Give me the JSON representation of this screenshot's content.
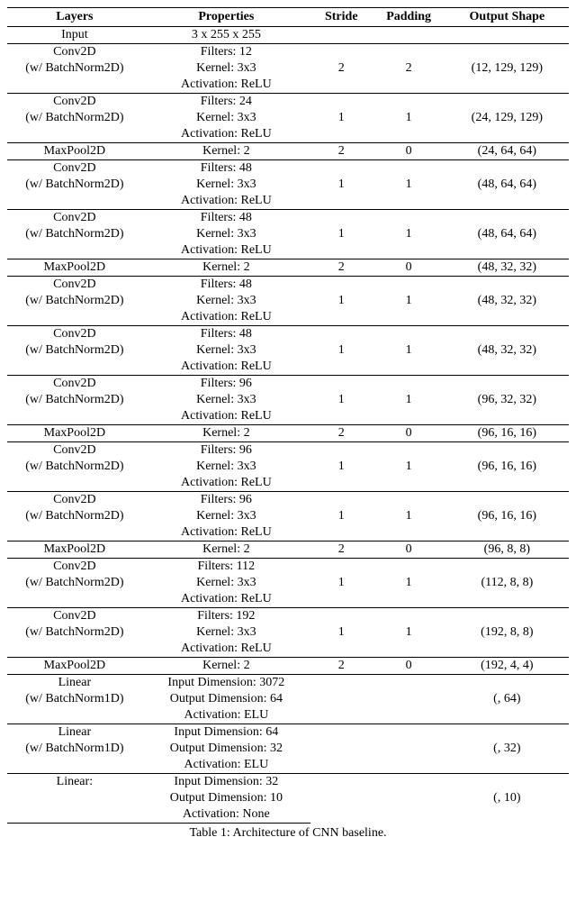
{
  "headers": [
    "Layers",
    "Properties",
    "Stride",
    "Padding",
    "Output Shape"
  ],
  "caption": "Table 1: Architecture of CNN baseline.",
  "rows": [
    {
      "type": "single",
      "layer": "Input",
      "properties": "3 x 255 x 255",
      "stride": "",
      "padding": "",
      "output": ""
    },
    {
      "type": "conv",
      "layer": "Conv2D",
      "sub": "(w/ BatchNorm2D)",
      "p1": "Filters: 12",
      "p2": "Kernel: 3x3",
      "p3": "Activation: ReLU",
      "stride": "2",
      "padding": "2",
      "output": "(12, 129, 129)"
    },
    {
      "type": "conv",
      "layer": "Conv2D",
      "sub": "(w/ BatchNorm2D)",
      "p1": "Filters: 24",
      "p2": "Kernel: 3x3",
      "p3": "Activation: ReLU",
      "stride": "1",
      "padding": "1",
      "output": "(24, 129, 129)"
    },
    {
      "type": "single",
      "layer": "MaxPool2D",
      "properties": "Kernel: 2",
      "stride": "2",
      "padding": "0",
      "output": "(24, 64, 64)"
    },
    {
      "type": "conv",
      "layer": "Conv2D",
      "sub": "(w/ BatchNorm2D)",
      "p1": "Filters: 48",
      "p2": "Kernel: 3x3",
      "p3": "Activation: ReLU",
      "stride": "1",
      "padding": "1",
      "output": "(48, 64, 64)"
    },
    {
      "type": "conv",
      "layer": "Conv2D",
      "sub": "(w/ BatchNorm2D)",
      "p1": "Filters: 48",
      "p2": "Kernel: 3x3",
      "p3": "Activation: ReLU",
      "stride": "1",
      "padding": "1",
      "output": "(48, 64, 64)"
    },
    {
      "type": "single",
      "layer": "MaxPool2D",
      "properties": "Kernel: 2",
      "stride": "2",
      "padding": "0",
      "output": "(48, 32, 32)"
    },
    {
      "type": "conv",
      "layer": "Conv2D",
      "sub": "(w/ BatchNorm2D)",
      "p1": "Filters: 48",
      "p2": "Kernel: 3x3",
      "p3": "Activation: ReLU",
      "stride": "1",
      "padding": "1",
      "output": "(48, 32, 32)"
    },
    {
      "type": "conv",
      "layer": "Conv2D",
      "sub": "(w/ BatchNorm2D)",
      "p1": "Filters: 48",
      "p2": "Kernel: 3x3",
      "p3": "Activation: ReLU",
      "stride": "1",
      "padding": "1",
      "output": "(48, 32, 32)"
    },
    {
      "type": "conv",
      "layer": "Conv2D",
      "sub": "(w/ BatchNorm2D)",
      "p1": "Filters: 96",
      "p2": "Kernel: 3x3",
      "p3": "Activation: ReLU",
      "stride": "1",
      "padding": "1",
      "output": "(96, 32, 32)"
    },
    {
      "type": "single",
      "layer": "MaxPool2D",
      "properties": "Kernel: 2",
      "stride": "2",
      "padding": "0",
      "output": "(96, 16, 16)"
    },
    {
      "type": "conv",
      "layer": "Conv2D",
      "sub": "(w/ BatchNorm2D)",
      "p1": "Filters: 96",
      "p2": "Kernel: 3x3",
      "p3": "Activation: ReLU",
      "stride": "1",
      "padding": "1",
      "output": "(96, 16, 16)"
    },
    {
      "type": "conv",
      "layer": "Conv2D",
      "sub": "(w/ BatchNorm2D)",
      "p1": "Filters: 96",
      "p2": "Kernel: 3x3",
      "p3": "Activation: ReLU",
      "stride": "1",
      "padding": "1",
      "output": "(96, 16, 16)"
    },
    {
      "type": "single",
      "layer": "MaxPool2D",
      "properties": "Kernel: 2",
      "stride": "2",
      "padding": "0",
      "output": "(96, 8, 8)"
    },
    {
      "type": "conv",
      "layer": "Conv2D",
      "sub": "(w/ BatchNorm2D)",
      "p1": "Filters: 112",
      "p2": "Kernel: 3x3",
      "p3": "Activation: ReLU",
      "stride": "1",
      "padding": "1",
      "output": "(112, 8, 8)"
    },
    {
      "type": "conv",
      "layer": "Conv2D",
      "sub": "(w/ BatchNorm2D)",
      "p1": "Filters: 192",
      "p2": "Kernel: 3x3",
      "p3": "Activation: ReLU",
      "stride": "1",
      "padding": "1",
      "output": "(192, 8, 8)"
    },
    {
      "type": "single",
      "layer": "MaxPool2D",
      "properties": "Kernel: 2",
      "stride": "2",
      "padding": "0",
      "output": "(192, 4, 4)"
    },
    {
      "type": "linear",
      "layer": "Linear",
      "sub": "(w/ BatchNorm1D)",
      "p1": "Input Dimension: 3072",
      "p2": "Output Dimension: 64",
      "p3": "Activation: ELU",
      "stride": "",
      "padding": "",
      "output": "(, 64)"
    },
    {
      "type": "linear",
      "layer": "Linear",
      "sub": "(w/ BatchNorm1D)",
      "p1": "Input Dimension: 64",
      "p2": "Output Dimension: 32",
      "p3": "Activation: ELU",
      "stride": "",
      "padding": "",
      "output": "(, 32)"
    },
    {
      "type": "linear",
      "layer": "Linear:",
      "sub": "",
      "p1": "Input Dimension: 32",
      "p2": "Output Dimension: 10",
      "p3": "Activation: None",
      "stride": "",
      "padding": "",
      "output": "(, 10)"
    }
  ]
}
